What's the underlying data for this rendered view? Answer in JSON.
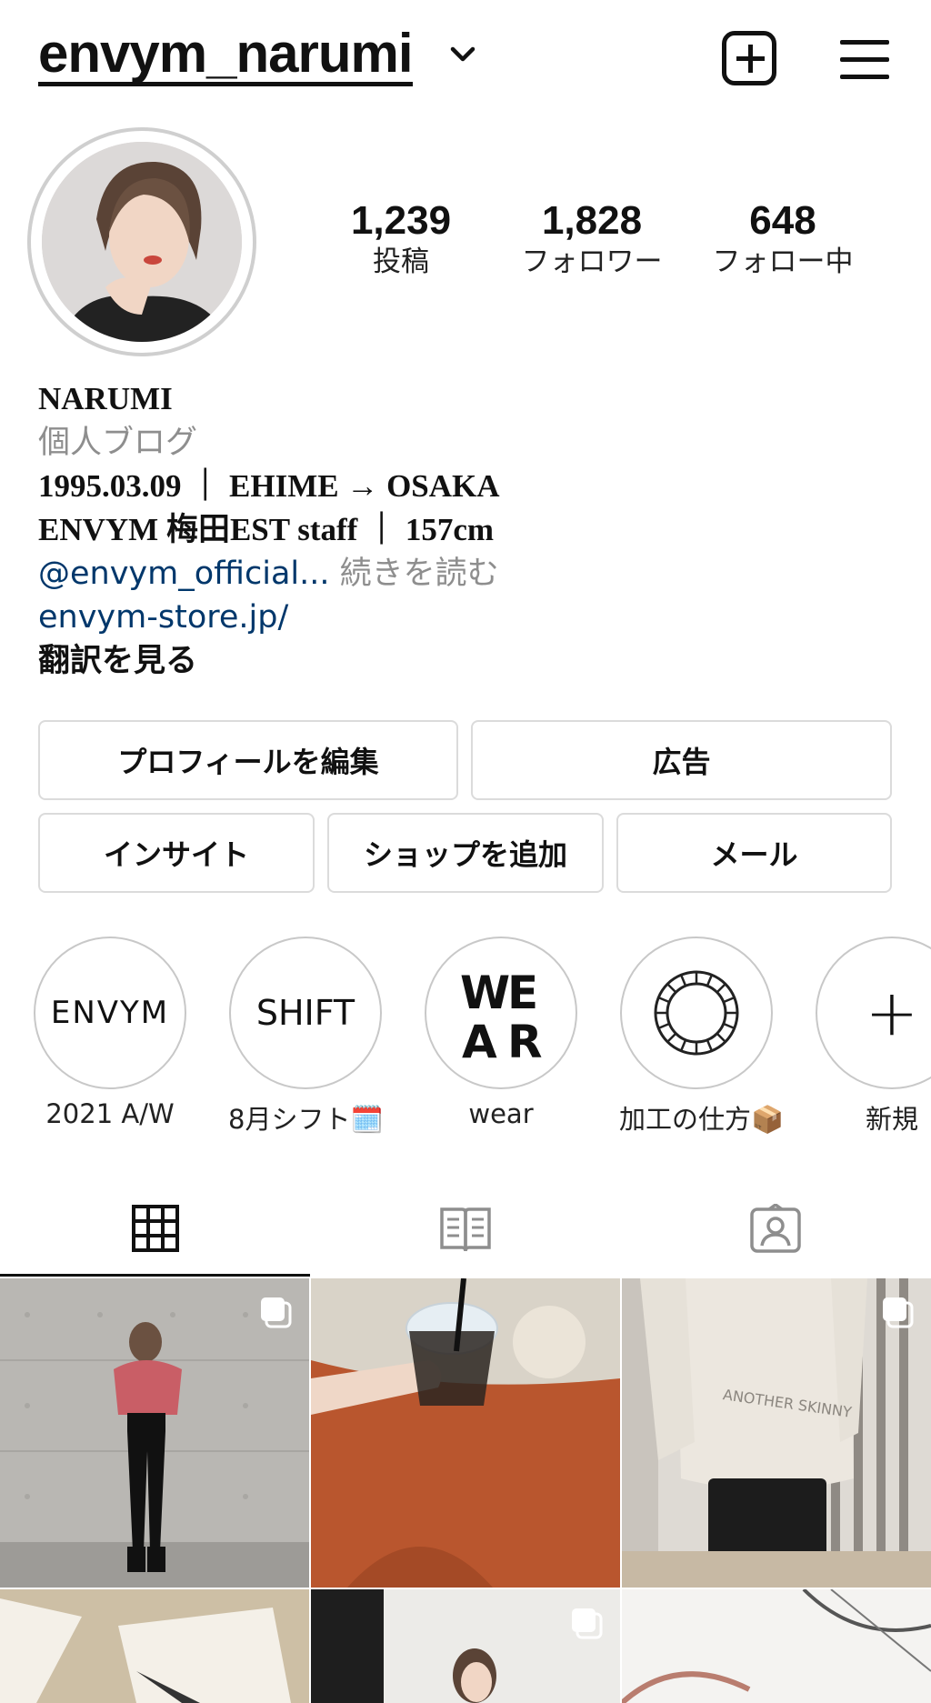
{
  "header": {
    "username": "envym_narumi"
  },
  "stats": [
    {
      "value": "1,239",
      "label": "投稿"
    },
    {
      "value": "1,828",
      "label": "フォロワー"
    },
    {
      "value": "648",
      "label": "フォロー中"
    }
  ],
  "bio": {
    "name": "NARUMI",
    "category": "個人ブログ",
    "line1": "1995.03.09 ｜ EHIME → OSAKA",
    "line2": "ENVYM 梅田EST staff ｜ 157cm",
    "mention": "@envym_official...",
    "more": " 続きを読む",
    "website": "envym-store.jp/",
    "translate": "翻訳を見る"
  },
  "buttons": {
    "edit_profile": "プロフィールを編集",
    "ads": "広告",
    "insights": "インサイト",
    "add_shop": "ショップを追加",
    "email": "メール"
  },
  "highlights": [
    {
      "cover": "ENVYM",
      "label": "2021 A/W"
    },
    {
      "cover": "SHIFT",
      "label": "8月シフト🗓️"
    },
    {
      "cover": "WEAR",
      "label": "wear"
    },
    {
      "cover": "",
      "label": "加工の仕方📦"
    },
    {
      "cover": "+",
      "label": "新規"
    }
  ]
}
